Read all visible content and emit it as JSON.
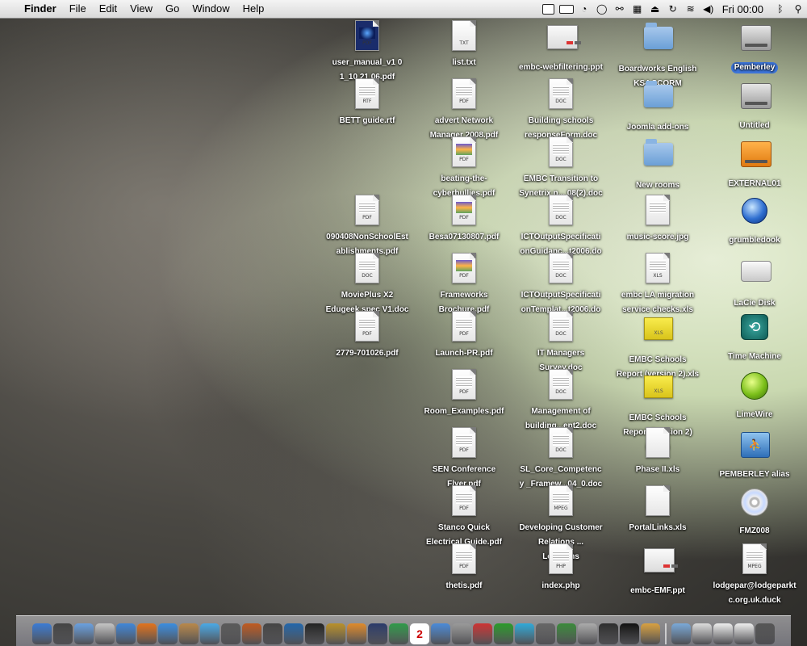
{
  "menubar": {
    "apple_glyph": "",
    "app_name": "Finder",
    "menus": [
      "File",
      "Edit",
      "View",
      "Go",
      "Window",
      "Help"
    ],
    "clock": "Fri 00:00"
  },
  "desktop": {
    "icons": [
      {
        "label": "user_manual_v1 0 1_10 21 06.pdf",
        "kind": "doc",
        "tag": "PDF",
        "style": "dark"
      },
      {
        "label": "list.txt",
        "kind": "doc",
        "tag": "TXT",
        "style": "blank"
      },
      {
        "label": "embc-webfiltering.ppt",
        "kind": "ppt"
      },
      {
        "label": "Boardworks English KS4 SCORM",
        "kind": "folder"
      },
      {
        "label": "Pemberley",
        "kind": "drive",
        "selected": true
      },
      {
        "label": "BETT guide.rtf",
        "kind": "doc",
        "tag": "RTF"
      },
      {
        "label": "advert Network Manager 2008.pdf",
        "kind": "doc",
        "tag": "PDF"
      },
      {
        "label": "Building schools responseForm.doc",
        "kind": "doc",
        "tag": "DOC"
      },
      {
        "label": "Joomla add-ons",
        "kind": "folder"
      },
      {
        "label": "Untitled",
        "kind": "drive"
      },
      {
        "label": "beating-the-cyberbullies.pdf",
        "kind": "doc",
        "tag": "PDF",
        "style": "colorful"
      },
      {
        "label": "EMBC Transition to Synetrix n... 08(2).doc",
        "kind": "doc",
        "tag": "DOC"
      },
      {
        "label": "New rooms",
        "kind": "folder"
      },
      {
        "label": "EXTERNAL01",
        "kind": "usb"
      },
      {
        "label": "090408NonSchoolEstablishments.pdf",
        "kind": "doc",
        "tag": "PDF"
      },
      {
        "label": "Besa07130807.pdf",
        "kind": "doc",
        "tag": "PDF",
        "style": "colorful"
      },
      {
        "label": "ICTOutputSpecificationGuidanc...t2006.doc",
        "kind": "doc",
        "tag": "DOC"
      },
      {
        "label": "music-score.jpg",
        "kind": "doc",
        "tag": ""
      },
      {
        "label": "grumbledook",
        "kind": "globe"
      },
      {
        "label": "MoviePlus X2 Edugeek spec V1.doc",
        "kind": "doc",
        "tag": "DOC"
      },
      {
        "label": "Frameworks Brochure.pdf",
        "kind": "doc",
        "tag": "PDF",
        "style": "colorful"
      },
      {
        "label": "ICTOutputSpecificationTemplat...t2006.doc",
        "kind": "doc",
        "tag": "DOC"
      },
      {
        "label": "embc LA migration service checks.xls",
        "kind": "doc",
        "tag": "XLS"
      },
      {
        "label": "LaCie Disk",
        "kind": "lacie"
      },
      {
        "label": "2779-701026.pdf",
        "kind": "doc",
        "tag": "PDF"
      },
      {
        "label": "Launch-PR.pdf",
        "kind": "doc",
        "tag": "PDF"
      },
      {
        "label": "IT Managers Survey.doc",
        "kind": "doc",
        "tag": "DOC"
      },
      {
        "label": "EMBC Schools Report (version 2).xls",
        "kind": "xls"
      },
      {
        "label": "Time Machine",
        "kind": "tm"
      },
      {
        "label": "Room_Examples.pdf",
        "kind": "doc",
        "tag": "PDF"
      },
      {
        "label": "Management of building...ent2.doc",
        "kind": "doc",
        "tag": "DOC"
      },
      {
        "label": "EMBC Schools Report (version 2)(2).xls",
        "kind": "xls"
      },
      {
        "label": "LimeWire",
        "kind": "lime"
      },
      {
        "label": "SEN Conference Flyer.pdf",
        "kind": "doc",
        "tag": "PDF"
      },
      {
        "label": "SL_Core_Competency _Framew...04_0.doc",
        "kind": "doc",
        "tag": "DOC"
      },
      {
        "label": "Phase II.xls",
        "kind": "doc",
        "tag": "",
        "style": "blank"
      },
      {
        "label": "PEMBERLEY alias",
        "kind": "alias"
      },
      {
        "label": "Stanco Quick Electrical Guide.pdf",
        "kind": "doc",
        "tag": "PDF"
      },
      {
        "label": "Developing Customer Relations ... Level.ims",
        "kind": "doc",
        "tag": "MPEG"
      },
      {
        "label": "PortalLinks.xls",
        "kind": "doc",
        "tag": "",
        "style": "blank"
      },
      {
        "label": "FMZ008",
        "kind": "cd"
      },
      {
        "label": "thetis.pdf",
        "kind": "doc",
        "tag": "PDF"
      },
      {
        "label": "index.php",
        "kind": "doc",
        "tag": "PHP"
      },
      {
        "label": "embc-EMF.ppt",
        "kind": "ppt"
      },
      {
        "label": "lodgepar@lodgeparktc.org.uk.duck",
        "kind": "doc",
        "tag": "MPEG"
      }
    ]
  },
  "dock": {
    "items": [
      "finder-icon",
      "dashboard-icon",
      "mail-icon",
      "preview-icon",
      "ichat-icon",
      "firefox-icon",
      "safari-icon",
      "address-book-icon",
      "itunes-icon",
      "photo-icon",
      "garageband-icon",
      "imovie-icon",
      "dvd-icon",
      "iphoto-star-icon",
      "iweb-icon",
      "keynote-icon",
      "photoshop-icon",
      "numbers-icon",
      "ical-icon",
      "quicktime-icon",
      "screen-icon",
      "lamp-icon",
      "messenger-icon",
      "skype-icon",
      "chrome-icon",
      "limewire-icon",
      "dash-icon",
      "brush-icon",
      "terminal-icon",
      "gallery-icon",
      "applications-folder-icon",
      "documents-icon",
      "doc-icon",
      "file-icon",
      "trash-icon"
    ]
  }
}
